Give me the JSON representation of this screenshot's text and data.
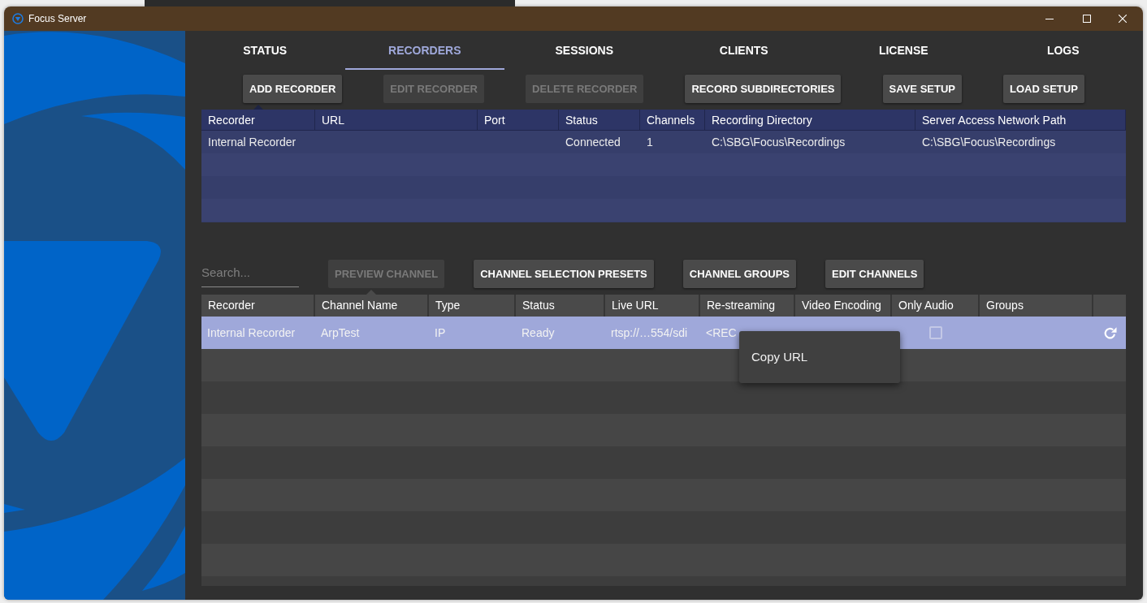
{
  "window": {
    "title": "Focus Server"
  },
  "tabs": [
    {
      "label": "STATUS",
      "selected": false
    },
    {
      "label": "RECORDERS",
      "selected": true
    },
    {
      "label": "SESSIONS",
      "selected": false
    },
    {
      "label": "CLIENTS",
      "selected": false
    },
    {
      "label": "LICENSE",
      "selected": false
    },
    {
      "label": "LOGS",
      "selected": false
    }
  ],
  "recorder_buttons": [
    {
      "label": "ADD RECORDER",
      "disabled": false
    },
    {
      "label": "EDIT RECORDER",
      "disabled": true
    },
    {
      "label": "DELETE RECORDER",
      "disabled": true
    },
    {
      "label": "RECORD SUBDIRECTORIES",
      "disabled": false
    },
    {
      "label": "SAVE SETUP",
      "disabled": false
    },
    {
      "label": "LOAD SETUP",
      "disabled": false
    }
  ],
  "recorders_table": {
    "columns": [
      {
        "label": "Recorder",
        "sorted": true
      },
      {
        "label": "URL",
        "sorted": false
      },
      {
        "label": "Port",
        "sorted": false
      },
      {
        "label": "Status",
        "sorted": false
      },
      {
        "label": "Channels",
        "sorted": false
      },
      {
        "label": "Recording Directory",
        "sorted": false
      },
      {
        "label": "Server Access Network Path",
        "sorted": false
      }
    ],
    "rows": [
      {
        "recorder": "Internal Recorder",
        "status": "Connected",
        "channels": "1",
        "recording_directory": "C:\\SBG\\Focus\\Recordings",
        "server_access_network_path": "C:\\SBG\\Focus\\Recordings"
      }
    ]
  },
  "channel_toolbar": {
    "search": {
      "placeholder": "Search..."
    },
    "buttons": [
      {
        "label": "PREVIEW CHANNEL",
        "disabled": true
      },
      {
        "label": "CHANNEL SELECTION PRESETS",
        "disabled": false
      },
      {
        "label": "CHANNEL GROUPS",
        "disabled": false
      },
      {
        "label": "EDIT CHANNELS",
        "disabled": false
      }
    ]
  },
  "channels_table": {
    "columns": [
      {
        "label": "Recorder",
        "sorted": false
      },
      {
        "label": "Channel Name",
        "sorted": true
      },
      {
        "label": "Type",
        "sorted": false
      },
      {
        "label": "Status",
        "sorted": false
      },
      {
        "label": "Live URL",
        "sorted": false
      },
      {
        "label": "Re-streaming",
        "sorted": false
      },
      {
        "label": "Video Encoding",
        "sorted": false
      },
      {
        "label": "Only Audio",
        "sorted": false
      },
      {
        "label": "Groups",
        "sorted": false
      }
    ],
    "rows": [
      {
        "selected": true,
        "recorder": "Internal Recorder",
        "channel_name": "ArpTest",
        "type": "IP",
        "status": "Ready",
        "live_url": "rtsp://…554/sdi",
        "re_streaming": "<REC",
        "only_audio": false
      }
    ]
  },
  "context_menu": {
    "items": [
      {
        "label": "Copy URL"
      }
    ]
  }
}
